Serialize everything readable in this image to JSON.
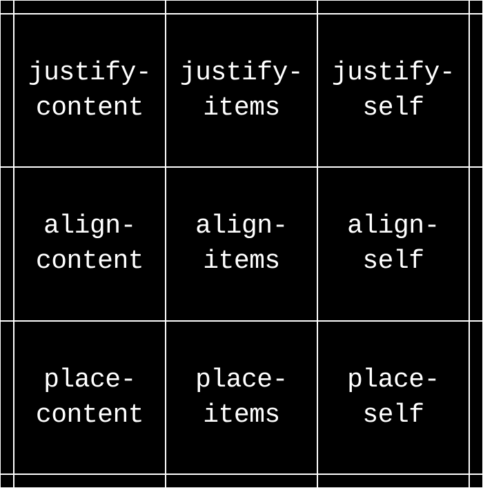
{
  "grid": {
    "rows": [
      {
        "cells": [
          {
            "name": "justify-content",
            "label": "justify-\ncontent"
          },
          {
            "name": "justify-items",
            "label": "justify-\nitems"
          },
          {
            "name": "justify-self",
            "label": "justify-\nself"
          }
        ]
      },
      {
        "cells": [
          {
            "name": "align-content",
            "label": "align-\ncontent"
          },
          {
            "name": "align-items",
            "label": "align-\nitems"
          },
          {
            "name": "align-self",
            "label": "align-\nself"
          }
        ]
      },
      {
        "cells": [
          {
            "name": "place-content",
            "label": "place-\ncontent"
          },
          {
            "name": "place-items",
            "label": "place-\nitems"
          },
          {
            "name": "place-self",
            "label": "place-\nself"
          }
        ]
      }
    ]
  }
}
